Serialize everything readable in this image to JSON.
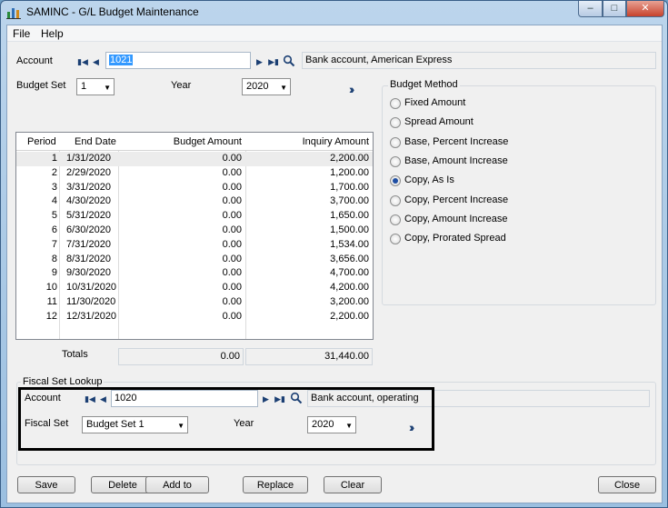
{
  "window": {
    "title": "SAMINC - G/L Budget Maintenance"
  },
  "menu": [
    "File",
    "Help"
  ],
  "account": {
    "label": "Account",
    "value": "1021",
    "description": "Bank account, American Express"
  },
  "budget_set": {
    "label": "Budget Set",
    "value": "1"
  },
  "year": {
    "label": "Year",
    "value": "2020"
  },
  "budget_method": {
    "title": "Budget Method",
    "options": [
      "Fixed Amount",
      "Spread Amount",
      "Base, Percent Increase",
      "Base, Amount Increase",
      "Copy, As Is",
      "Copy, Percent Increase",
      "Copy, Amount Increase",
      "Copy, Prorated Spread"
    ],
    "selected_index": 4
  },
  "table": {
    "headers": [
      "Period",
      "End Date",
      "Budget Amount",
      "Inquiry Amount"
    ],
    "rows": [
      [
        "1",
        "1/31/2020",
        "0.00",
        "2,200.00"
      ],
      [
        "2",
        "2/29/2020",
        "0.00",
        "1,200.00"
      ],
      [
        "3",
        "3/31/2020",
        "0.00",
        "1,700.00"
      ],
      [
        "4",
        "4/30/2020",
        "0.00",
        "3,700.00"
      ],
      [
        "5",
        "5/31/2020",
        "0.00",
        "1,650.00"
      ],
      [
        "6",
        "6/30/2020",
        "0.00",
        "1,500.00"
      ],
      [
        "7",
        "7/31/2020",
        "0.00",
        "1,534.00"
      ],
      [
        "8",
        "8/31/2020",
        "0.00",
        "3,656.00"
      ],
      [
        "9",
        "9/30/2020",
        "0.00",
        "4,700.00"
      ],
      [
        "10",
        "10/31/2020",
        "0.00",
        "4,200.00"
      ],
      [
        "11",
        "11/30/2020",
        "0.00",
        "3,200.00"
      ],
      [
        "12",
        "12/31/2020",
        "0.00",
        "2,200.00"
      ]
    ]
  },
  "totals": {
    "label": "Totals",
    "budget": "0.00",
    "inquiry": "31,440.00"
  },
  "fiscal_lookup": {
    "title": "Fiscal Set Lookup",
    "account_label": "Account",
    "account_value": "1020",
    "account_description": "Bank account, operating",
    "fiscal_set_label": "Fiscal Set",
    "fiscal_set_value": "Budget Set 1",
    "year_label": "Year",
    "year_value": "2020"
  },
  "buttons": {
    "save": "Save",
    "delete": "Delete",
    "add_to": "Add to",
    "replace": "Replace",
    "clear": "Clear",
    "close": "Close"
  },
  "colors": {
    "selection": "#3399ff",
    "nav_icon": "#1b3f73",
    "highlight_border": "#000000"
  }
}
